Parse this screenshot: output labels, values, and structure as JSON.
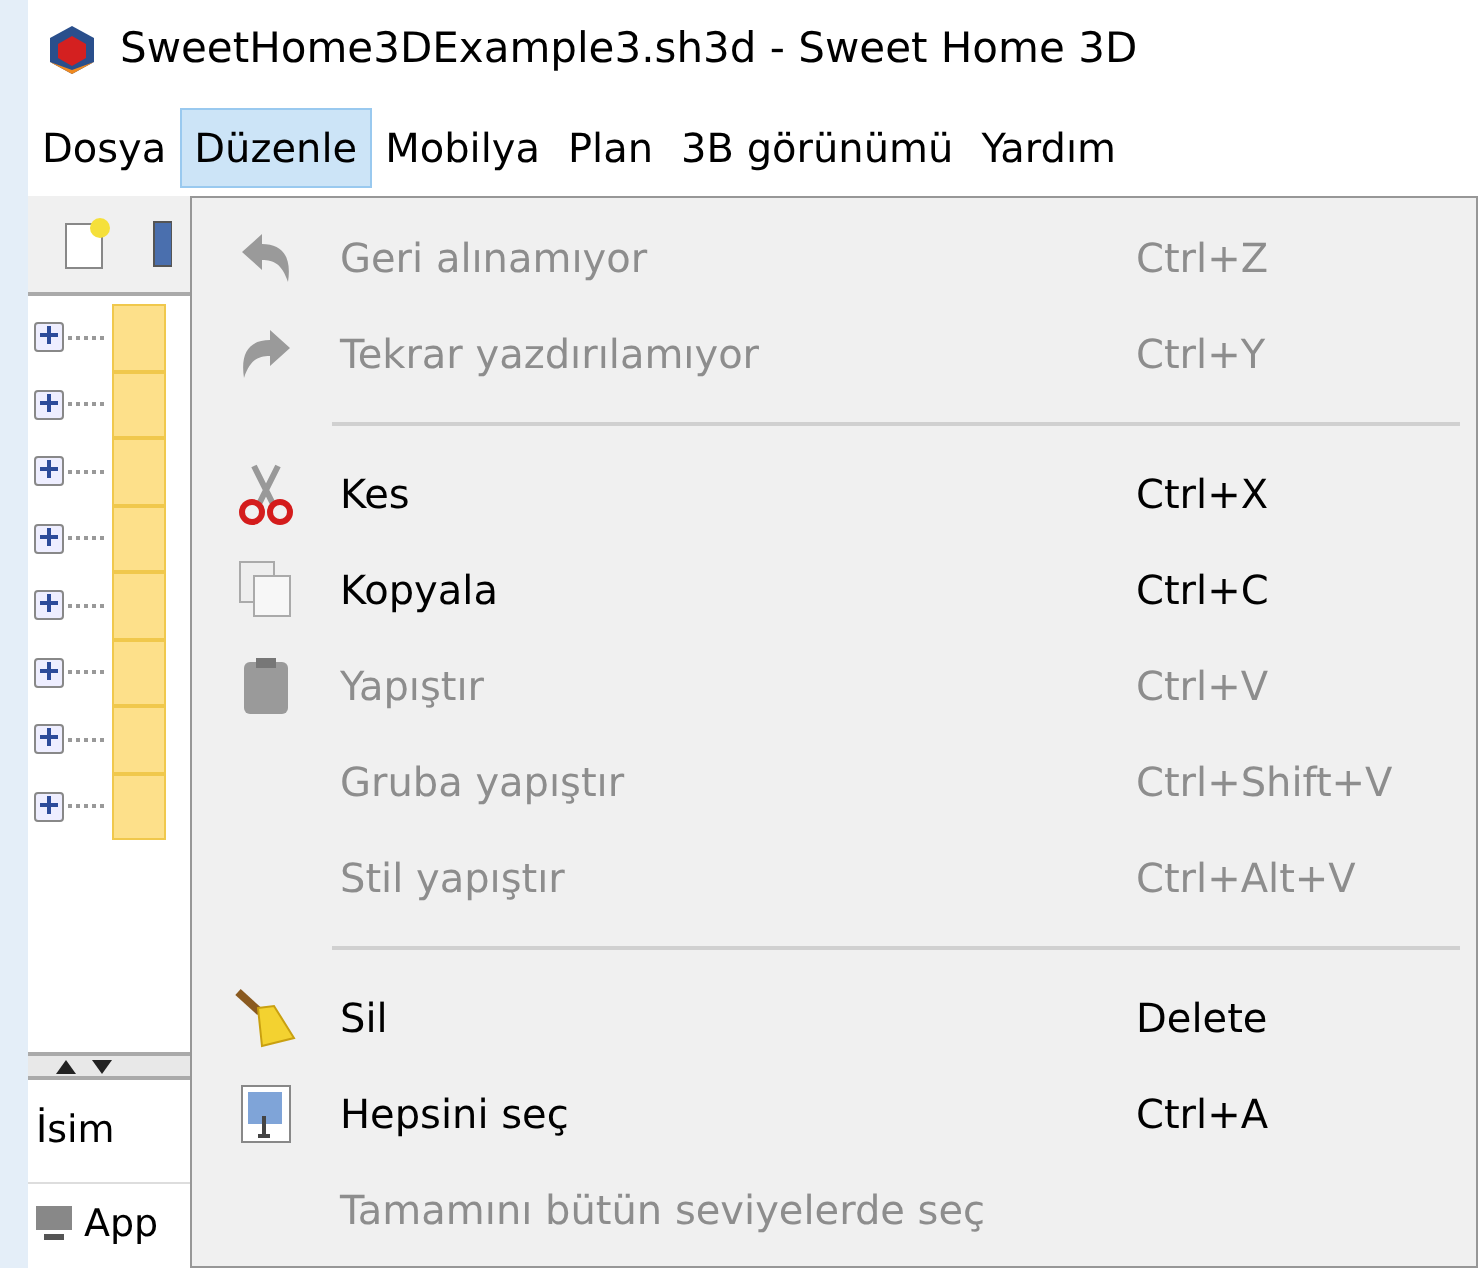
{
  "window": {
    "title": "SweetHome3DExample3.sh3d - Sweet Home 3D"
  },
  "menu_bar": [
    {
      "label": "Dosya",
      "selected": false
    },
    {
      "label": "Düzenle",
      "selected": true
    },
    {
      "label": "Mobilya",
      "selected": false
    },
    {
      "label": "Plan",
      "selected": false
    },
    {
      "label": "3B görünümü",
      "selected": false
    },
    {
      "label": "Yardım",
      "selected": false
    }
  ],
  "tree": [
    {
      "expanded": false
    },
    {
      "expanded": false
    },
    {
      "expanded": false
    },
    {
      "expanded": false
    },
    {
      "expanded": false
    },
    {
      "expanded": false
    },
    {
      "expanded": false
    },
    {
      "expanded": false
    }
  ],
  "furniture_table": {
    "columns": [
      "İsim"
    ],
    "rows": [
      [
        "App"
      ]
    ]
  },
  "menu": [
    {
      "kind": "item",
      "label": "Geri alınamıyor",
      "shortcut": "Ctrl+Z",
      "disabled": true
    },
    {
      "kind": "item",
      "label": "Tekrar yazdırılamıyor",
      "shortcut": "Ctrl+Y",
      "disabled": true
    },
    {
      "kind": "separator"
    },
    {
      "kind": "item",
      "label": "Kes",
      "shortcut": "Ctrl+X",
      "disabled": false
    },
    {
      "kind": "item",
      "label": "Kopyala",
      "shortcut": "Ctrl+C",
      "disabled": false
    },
    {
      "kind": "item",
      "label": "Yapıştır",
      "shortcut": "Ctrl+V",
      "disabled": true
    },
    {
      "kind": "item",
      "label": "Gruba yapıştır",
      "shortcut": "Ctrl+Shift+V",
      "disabled": true
    },
    {
      "kind": "item",
      "label": "Stil yapıştır",
      "shortcut": "Ctrl+Alt+V",
      "disabled": true
    },
    {
      "kind": "separator"
    },
    {
      "kind": "item",
      "label": "Sil",
      "shortcut": "Delete",
      "disabled": false
    },
    {
      "kind": "item",
      "label": "Hepsini seç",
      "shortcut": "Ctrl+A",
      "disabled": false
    },
    {
      "kind": "item",
      "label": "Tamamını bütün seviyelerde seç",
      "disabled": true
    }
  ]
}
